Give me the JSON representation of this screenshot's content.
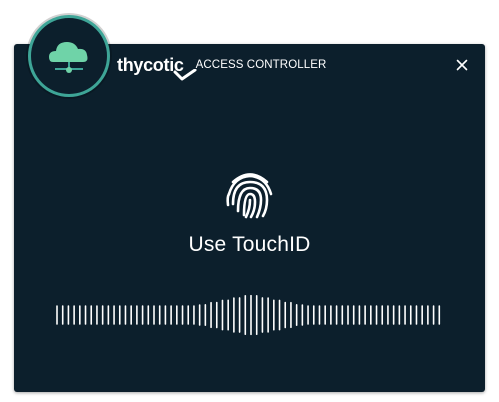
{
  "brand": {
    "name": "thycotic",
    "product": "ACCESS CONTROLLER",
    "accent_color": "#3ea597",
    "background_color": "#0c1f2c"
  },
  "icons": {
    "logo": "cloud-network-icon",
    "close": "close-icon",
    "fingerprint": "fingerprint-icon",
    "waveform": "waveform-icon"
  },
  "main": {
    "prompt": "Use TouchID"
  }
}
